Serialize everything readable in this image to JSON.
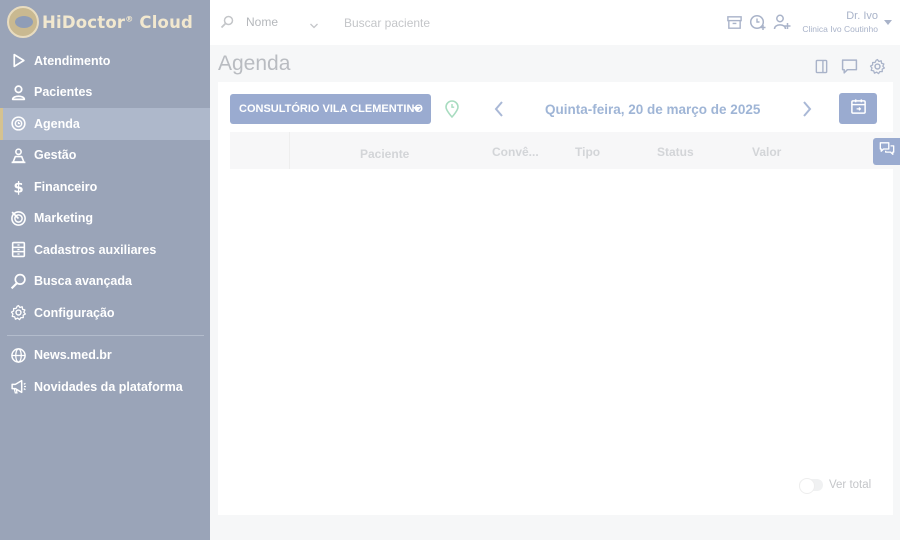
{
  "app": {
    "logo_text": "HiDoctor",
    "logo_reg": "®",
    "logo_suffix": " Cloud"
  },
  "sidebar": {
    "items": [
      {
        "label": "Atendimento",
        "icon": "play-icon"
      },
      {
        "label": "Pacientes",
        "icon": "user-icon"
      },
      {
        "label": "Agenda",
        "icon": "calendar-clock-icon",
        "active": true
      },
      {
        "label": "Gestão",
        "icon": "management-icon"
      },
      {
        "label": "Financeiro",
        "icon": "dollar-icon"
      },
      {
        "label": "Marketing",
        "icon": "target-icon"
      },
      {
        "label": "Cadastros auxiliares",
        "icon": "records-icon"
      },
      {
        "label": "Busca avançada",
        "icon": "advanced-search-icon"
      },
      {
        "label": "Configuração",
        "icon": "gear-icon"
      }
    ],
    "extra_items": [
      {
        "label": "News.med.br",
        "icon": "globe-icon"
      },
      {
        "label": "Novidades da plataforma",
        "icon": "megaphone-icon"
      }
    ]
  },
  "topbar": {
    "search_field": "Nome",
    "search_placeholder": "Buscar paciente",
    "user_name": "Dr. Ivo",
    "user_clinic": "Clinica Ivo Coutinho"
  },
  "page": {
    "title": "Agenda"
  },
  "agenda": {
    "office": "CONSULTÓRIO VILA CLEMENTINO",
    "date": "Quinta-feira, 20 de março de 2025",
    "columns": [
      "Paciente",
      "Convê...",
      "Tipo",
      "Status",
      "Valor"
    ],
    "ver_total_label": "Ver total",
    "ver_total_on": false
  },
  "colors": {
    "sidebar": "#9aa4b8",
    "accent": "#9aabd0",
    "active_marker": "#d5c28f"
  }
}
